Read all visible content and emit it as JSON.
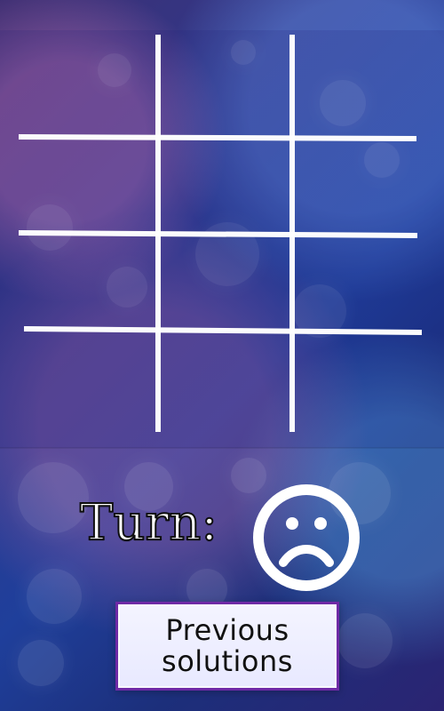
{
  "turn": {
    "label": "Turn:",
    "icon": "sad-face-icon"
  },
  "button": {
    "previous_solutions_line1": "Previous",
    "previous_solutions_line2": "solutions"
  },
  "board": {
    "cells": [
      "",
      "",
      "",
      "",
      "",
      "",
      "",
      "",
      ""
    ]
  },
  "colors": {
    "grid": "#ffffff",
    "button_border": "#6f2aa6",
    "button_bg": "#eef0ff"
  }
}
